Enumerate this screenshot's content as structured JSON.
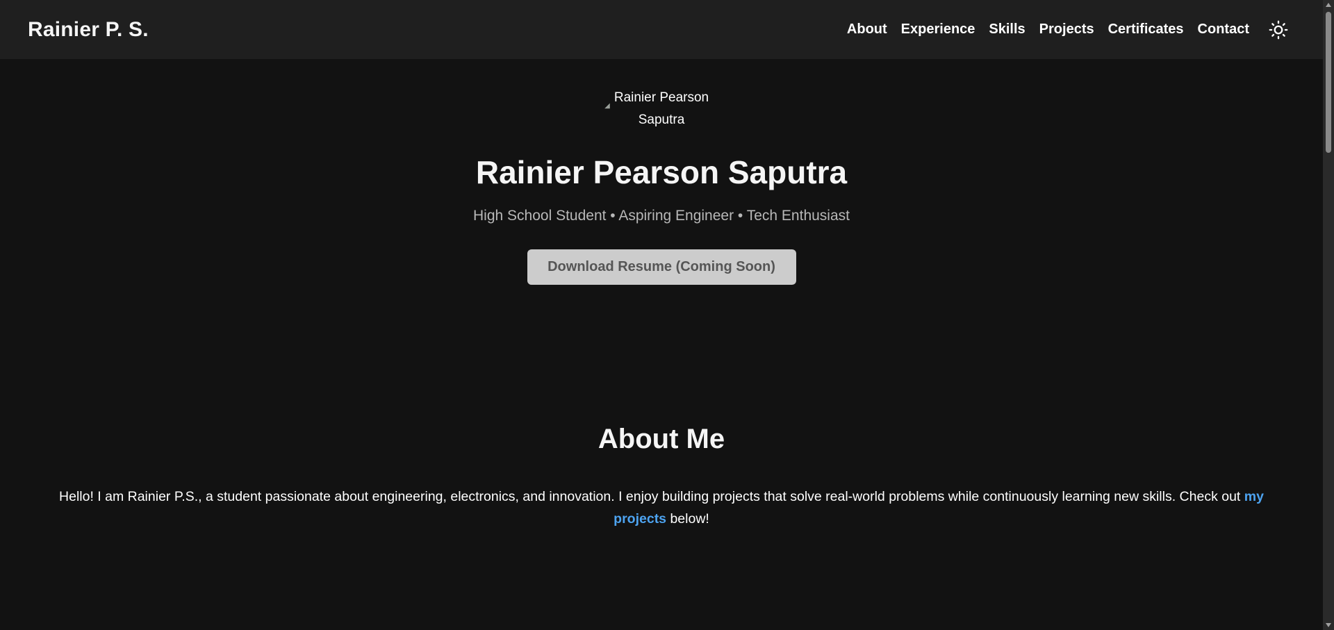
{
  "header": {
    "brand": "Rainier P. S.",
    "nav": [
      "About",
      "Experience",
      "Skills",
      "Projects",
      "Certificates",
      "Contact"
    ],
    "theme_toggle_icon": "sun-icon"
  },
  "hero": {
    "avatar_alt": "Rainier Pearson Saputra",
    "name": "Rainier Pearson Saputra",
    "tagline": "High School Student • Aspiring Engineer • Tech Enthusiast",
    "resume_button": "Download Resume (Coming Soon)"
  },
  "about": {
    "heading": "About Me",
    "text_before": "Hello! I am Rainier P.S., a student passionate about engineering, electronics, and innovation. I enjoy building projects that solve real-world problems while continuously learning new skills. Check out ",
    "link": "my projects",
    "text_after": " below!"
  },
  "colors": {
    "background": "#121212",
    "header": "#1f1f1f",
    "link": "#4da3f0",
    "button": "#cccccc"
  }
}
